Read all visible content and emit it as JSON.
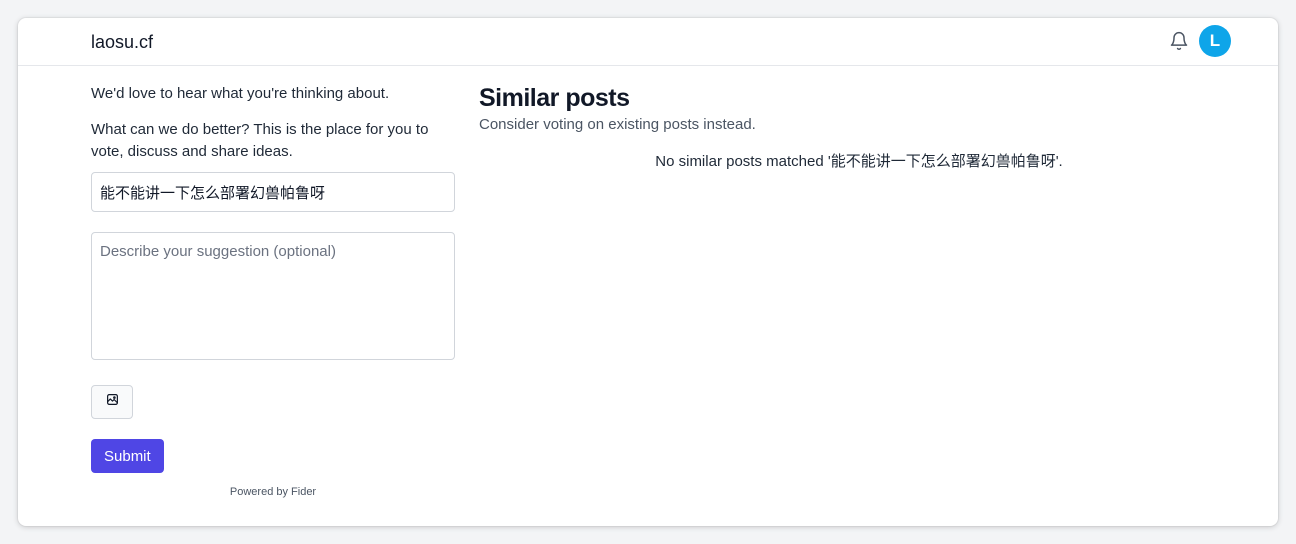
{
  "header": {
    "site_title": "laosu.cf",
    "notification_icon": "bell-icon",
    "avatar_initial": "L",
    "avatar_color": "#0ea5e9"
  },
  "form": {
    "welcome_text": "We'd love to hear what you're thinking about.",
    "invite_text": "What can we do better? This is the place for you to vote, discuss and share ideas.",
    "title_value": "能不能讲一下怎么部署幻兽帕鲁呀",
    "description_placeholder": "Describe your suggestion (optional)",
    "attach_icon": "image-icon",
    "submit_label": "Submit",
    "submit_color": "#4f46e5",
    "powered_by": "Powered by Fider"
  },
  "similar": {
    "title": "Similar posts",
    "subtitle": "Consider voting on existing posts instead.",
    "no_match_text": "No similar posts matched '能不能讲一下怎么部署幻兽帕鲁呀'."
  }
}
